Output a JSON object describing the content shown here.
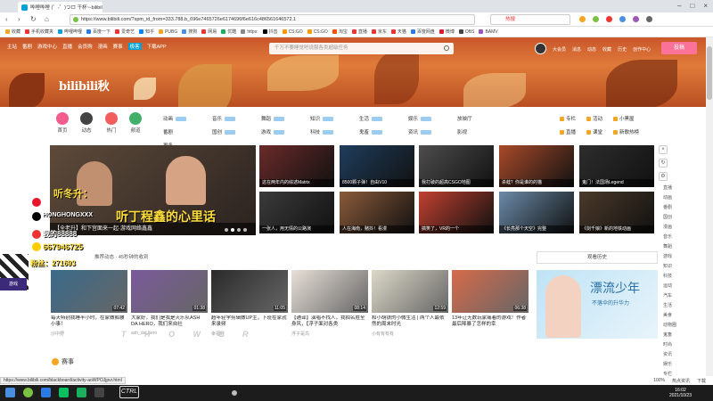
{
  "browser": {
    "tab_title": "哔哩哔哩 (゜-゜)つロ 干杯~-bilibili",
    "url": "https://www.bilibili.com/?spm_id_from=333.788.b_696e7465726e6174696f6e616c486561646572.1",
    "search_hot": "热搜",
    "status_url": "https://www.bilibili.com/blackboard/activity-aoWPOJjpvr.html",
    "bookmarks": [
      "收藏",
      "手机收藏夹",
      "哔哩哔哩",
      "百度一下",
      "爱奇艺",
      "知乎",
      "PUBG",
      "搜狗",
      "网易",
      "优酷",
      "https:",
      "抖音",
      "CS:GO",
      "CS:GO",
      "淘宝",
      "直播",
      "京东",
      "天猫",
      "百度网盘",
      "微博",
      "OBS",
      "BAMV"
    ],
    "status_items": [
      "100%",
      "热点资讯",
      "下载"
    ]
  },
  "header": {
    "nav": [
      "主站",
      "番剧",
      "游戏中心",
      "直播",
      "会员购",
      "漫画",
      "赛事",
      "极客",
      "下载APP"
    ],
    "search_placeholder": "千万不要睡觉吧说服各类超级任务",
    "right_nav": [
      "大会员",
      "消息",
      "动态",
      "收藏",
      "历史",
      "创作中心"
    ],
    "upload": "投稿",
    "logo": "bilibili秋"
  },
  "channels": {
    "big": [
      {
        "label": "首页",
        "color": "#f25d8e"
      },
      {
        "label": "动态",
        "color": "#444444"
      },
      {
        "label": "热门",
        "color": "#f25d5d"
      },
      {
        "label": "频道",
        "color": "#41b06a"
      }
    ],
    "grid": [
      "动画",
      "音乐",
      "舞蹈",
      "知识",
      "生活",
      "娱乐",
      "放映厅",
      "番剧",
      "国创",
      "游戏",
      "科技",
      "鬼畜",
      "资讯",
      "影视",
      "更多"
    ],
    "extra": [
      "专栏",
      "活动",
      "小黑屋",
      "直播",
      "课堂",
      "新歌热榜"
    ]
  },
  "feed": {
    "carousel_caption": "【全老升】和下宫面来一起·游戏网络鑫鑫",
    "carousel_text": "听丁程鑫的心里话",
    "thumbs": [
      "这在两年内的综述Matrix",
      "8500颗子弹！自由V10",
      "我打破的超高CSGO地图",
      "杀蛙？你是谁的的猫",
      "鬼门！法国场Legend",
      "一张人，用无情的公路演",
      "人在海南，赌抖！看漫",
      "搞笑了，VR的一个",
      "《长亮那个天空》完整",
      "《剑千娘》新的地铁动画"
    ],
    "rec_header": "推荐动态 · 45秒钟的收到",
    "rank_header": "观看历史",
    "cards": [
      {
        "title": "每天特别我睡半小时，在家做裤腰小事！",
        "up": "沙中野",
        "dur": "07:42"
      },
      {
        "title": "大家好，我们是我是灭乐队ASH DA HERO，我们来自社",
        "up": "ash_da_hero",
        "dur": "01:38"
      },
      {
        "title": "超年轻学剪辑做UP主，下班在家就来录频",
        "up": "幸福鞋",
        "dur": "11:05"
      },
      {
        "title": "【通译】演唱不找人，我拍名胜全身风，【浮子面对各类",
        "up": "浮子是鸟",
        "dur": "08:14"
      },
      {
        "title": "和小胡铁的小微生活 | 两个人最依然的周末时光",
        "up": "小有有有有",
        "dur": "12:59"
      },
      {
        "title": "13年让无数玩家痛着的游戏！作者最后降暴了怎样的幸",
        "up": "",
        "dur": "06:38"
      }
    ],
    "ad_title": "漂流少年",
    "ad_sub": "不落伞的升华力",
    "race_label": "赛事"
  },
  "side_nav": [
    "直播",
    "动画",
    "番剧",
    "国创",
    "漫画",
    "音乐",
    "舞蹈",
    "游戏",
    "知识",
    "科技",
    "运动",
    "汽车",
    "生活",
    "美食",
    "动物圈",
    "鬼畜",
    "时尚",
    "资讯",
    "娱乐",
    "专栏"
  ],
  "overlay": {
    "name1": "听冬升：",
    "sub1": "HONGHONGXXX",
    "text1": "听丁程鑫的心里话",
    "id1": "我的88888",
    "id2": "667946725",
    "fans": "粉丝：271693",
    "ghost": "T H O W E R",
    "dept": "游戏"
  },
  "taskbar": {
    "ctrl": "CTRL",
    "time": "16:02",
    "date": "2021/10/23"
  },
  "colors": {
    "accent": "#00a1d6",
    "pink": "#fb7299",
    "banner": "#c9562a"
  }
}
